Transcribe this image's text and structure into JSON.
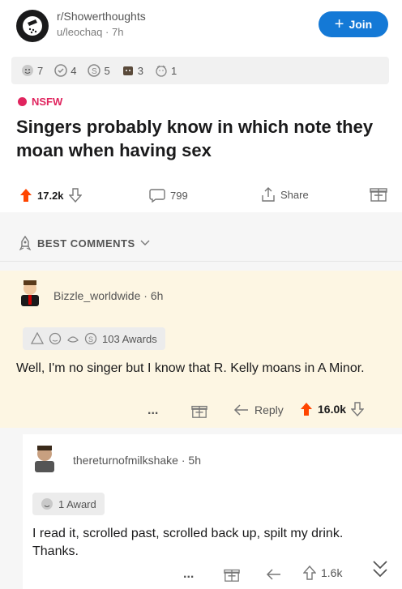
{
  "post": {
    "subreddit": "r/Showerthoughts",
    "author": "u/leochaq",
    "age": "7h",
    "join_label": "Join",
    "awards": [
      {
        "icon": "wholesome-award-icon",
        "count": "7"
      },
      {
        "icon": "helpful-award-icon",
        "count": "4"
      },
      {
        "icon": "silver-award-icon",
        "count": "5"
      },
      {
        "icon": "bear-award-icon",
        "count": "3"
      },
      {
        "icon": "hug-award-icon",
        "count": "1"
      }
    ],
    "nsfw_label": "NSFW",
    "title": "Singers probably know in which note they moan when having sex",
    "votes": "17.2k",
    "comments": "799",
    "share_label": "Share"
  },
  "sort": {
    "label": "BEST COMMENTS"
  },
  "comments": [
    {
      "author": "Bizzle_worldwide",
      "age": "6h",
      "awards_label": "103 Awards",
      "body": "Well, I'm no singer but I know that R. Kelly moans in A Minor.",
      "more_label": "...",
      "reply_label": "Reply",
      "votes": "16.0k"
    },
    {
      "author": "thereturnofmilkshake",
      "age": "5h",
      "awards_label": "1 Award",
      "body": "I read it, scrolled past, scrolled back up, spilt my drink. Thanks.",
      "more_label": "...",
      "votes": "1.6k"
    }
  ],
  "colors": {
    "accent": "#1479d6",
    "upvote": "#ff4500",
    "nsfw": "#e0245e",
    "highlight_bg": "#fdf6e3"
  }
}
